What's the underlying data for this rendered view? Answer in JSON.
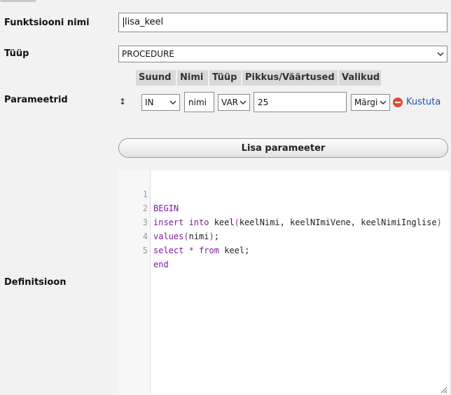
{
  "form": {
    "name_label": "Funktsiooni nimi",
    "name_value": "lisa_keel",
    "type_label": "Tüüp",
    "type_value": "PROCEDURE",
    "params_label": "Parameetrid",
    "definition_label": "Definitsioon"
  },
  "params": {
    "headers": [
      "Suund",
      "Nimi",
      "Tüüp",
      "Pikkus/Väärtused",
      "Valikud"
    ],
    "row": {
      "direction": "IN",
      "name": "nimi",
      "type": "VARCHAR",
      "length": "25",
      "options": "Märgistik",
      "delete_label": "Kustuta"
    },
    "sort_handle": "↕"
  },
  "add_param_label": "Lisa parameeter",
  "editor": {
    "line_numbers": [
      "1",
      "2",
      "3",
      "4",
      "5"
    ]
  },
  "icons": {
    "select_arrow": "chevron-down-icon",
    "delete": "remove-circle-icon",
    "resize": "resize-grip-icon"
  },
  "colors": {
    "keyword": "#7a1ea1",
    "link": "#1a55a8",
    "delete_icon": "#e04a3a"
  }
}
